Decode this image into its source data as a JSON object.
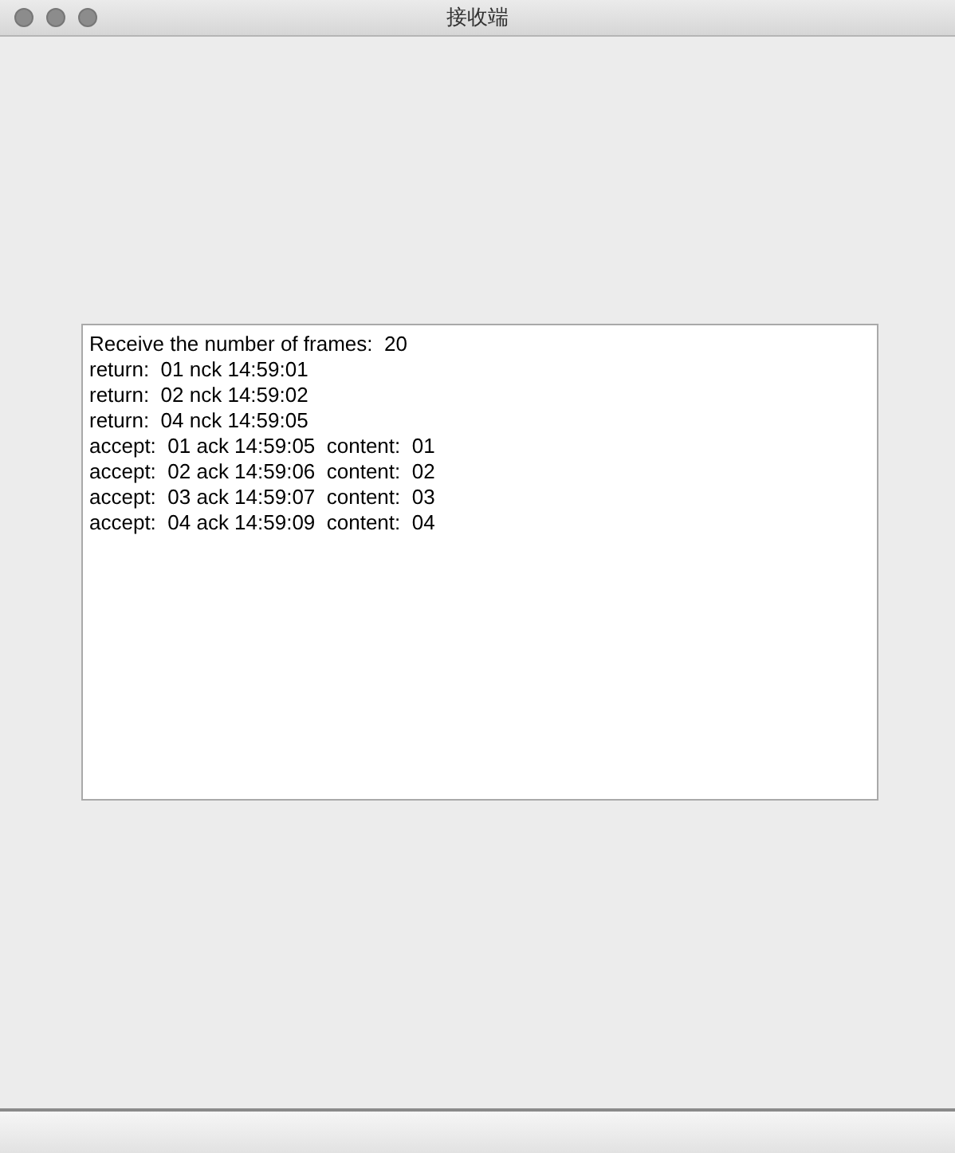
{
  "window": {
    "title": "接收端"
  },
  "log": {
    "lines": [
      "Receive the number of frames:  20",
      "return:  01 nck 14:59:01",
      "return:  02 nck 14:59:02",
      "return:  04 nck 14:59:05",
      "accept:  01 ack 14:59:05  content:  01",
      "accept:  02 ack 14:59:06  content:  02",
      "accept:  03 ack 14:59:07  content:  03",
      "accept:  04 ack 14:59:09  content:  04"
    ]
  }
}
